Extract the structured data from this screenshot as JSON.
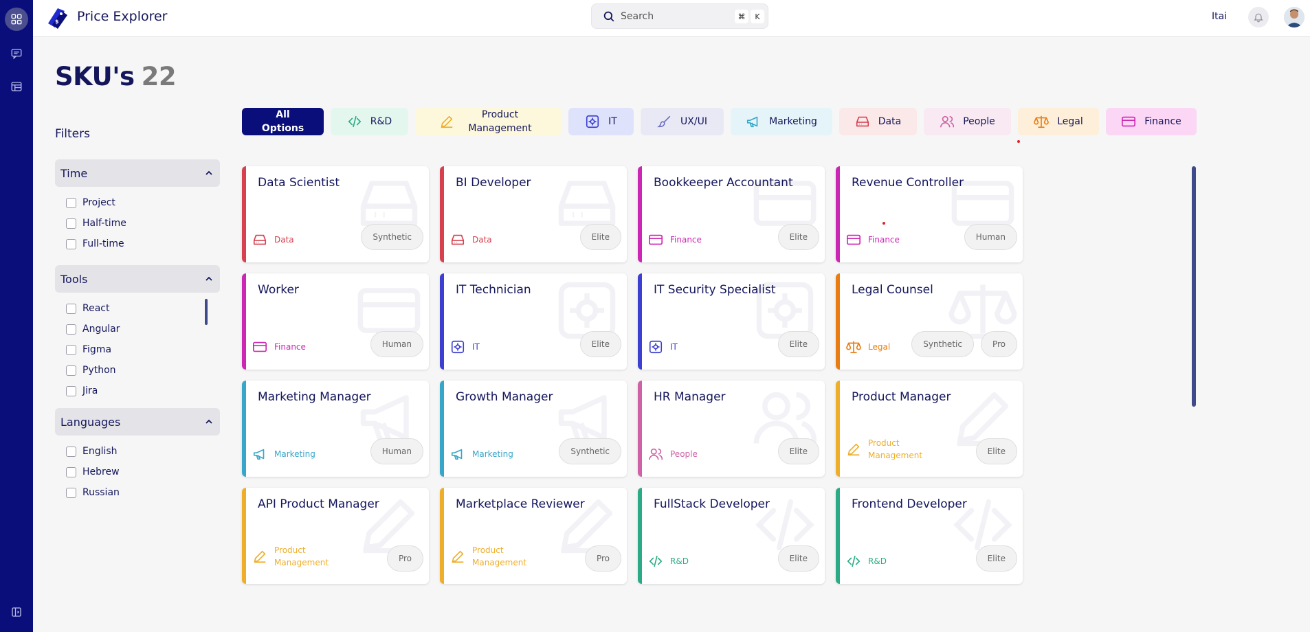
{
  "app": {
    "title": "Price Explorer"
  },
  "search": {
    "placeholder": "Search",
    "shortcut": [
      "⌘",
      "K"
    ]
  },
  "user": {
    "name": "Itai"
  },
  "page": {
    "title": "SKU's",
    "count": "22"
  },
  "filters": {
    "title": "Filters",
    "groups": [
      {
        "label": "Time",
        "options": [
          "Project",
          "Half-time",
          "Full-time"
        ]
      },
      {
        "label": "Tools",
        "options": [
          "React",
          "Angular",
          "Figma",
          "Python",
          "Jira"
        ]
      },
      {
        "label": "Languages",
        "options": [
          "English",
          "Hebrew",
          "Russian"
        ]
      }
    ]
  },
  "categories": [
    {
      "label": "All Options",
      "icon": "none"
    },
    {
      "label": "R&D",
      "icon": "code-icon",
      "color": "#2aab85",
      "bg": "#e4f7ef"
    },
    {
      "label": "Product Management",
      "icon": "pencil-icon",
      "color": "#efae2a",
      "bg": "#fdf8dc"
    },
    {
      "label": "IT",
      "icon": "chip-icon",
      "color": "#3c3fd0",
      "bg": "#dfe2fb"
    },
    {
      "label": "UX/UI",
      "icon": "paintbrush-icon",
      "color": "#6a6fbf",
      "bg": "#e9e9f6"
    },
    {
      "label": "Marketing",
      "icon": "megaphone-icon",
      "color": "#37a6c8",
      "bg": "#e5f4f9"
    },
    {
      "label": "Data",
      "icon": "drive-icon",
      "color": "#d6404f",
      "bg": "#fbe9ea"
    },
    {
      "label": "People",
      "icon": "people-icon",
      "color": "#cf62a6",
      "bg": "#f8e9f2"
    },
    {
      "label": "Legal",
      "icon": "scale-icon",
      "color": "#e97d12",
      "bg": "#fdefd9"
    },
    {
      "label": "Finance",
      "icon": "card-icon",
      "color": "#cc26b4",
      "bg": "#fbd6f5"
    }
  ],
  "cards": [
    {
      "title": "Data Scientist",
      "category": "Data",
      "tags": [
        "Synthetic"
      ]
    },
    {
      "title": "BI Developer",
      "category": "Data",
      "tags": [
        "Elite"
      ]
    },
    {
      "title": "Bookkeeper Accountant",
      "category": "Finance",
      "tags": [
        "Elite"
      ]
    },
    {
      "title": "Revenue Controller",
      "category": "Finance",
      "tags": [
        "Human"
      ]
    },
    {
      "title": "Worker",
      "category": "Finance",
      "tags": [
        "Human"
      ]
    },
    {
      "title": "IT Technician",
      "category": "IT",
      "tags": [
        "Elite"
      ]
    },
    {
      "title": "IT Security Specialist",
      "category": "IT",
      "tags": [
        "Elite"
      ]
    },
    {
      "title": "Legal Counsel",
      "category": "Legal",
      "tags": [
        "Synthetic",
        "Pro"
      ]
    },
    {
      "title": "Marketing Manager",
      "category": "Marketing",
      "tags": [
        "Human"
      ]
    },
    {
      "title": "Growth Manager",
      "category": "Marketing",
      "tags": [
        "Synthetic"
      ]
    },
    {
      "title": "HR Manager",
      "category": "People",
      "tags": [
        "Elite"
      ]
    },
    {
      "title": "Product Manager",
      "category": "Product Management",
      "tags": [
        "Elite"
      ]
    },
    {
      "title": "API Product Manager",
      "category": "Product Management",
      "tags": [
        "Pro"
      ]
    },
    {
      "title": "Marketplace Reviewer",
      "category": "Product Management",
      "tags": [
        "Pro"
      ]
    },
    {
      "title": "FullStack Developer",
      "category": "R&D",
      "tags": [
        "Elite"
      ]
    },
    {
      "title": "Frontend Developer",
      "category": "R&D",
      "tags": [
        "Elite"
      ]
    }
  ],
  "colors": {
    "rail": "#0a0e7a",
    "accent": "#14165c"
  }
}
